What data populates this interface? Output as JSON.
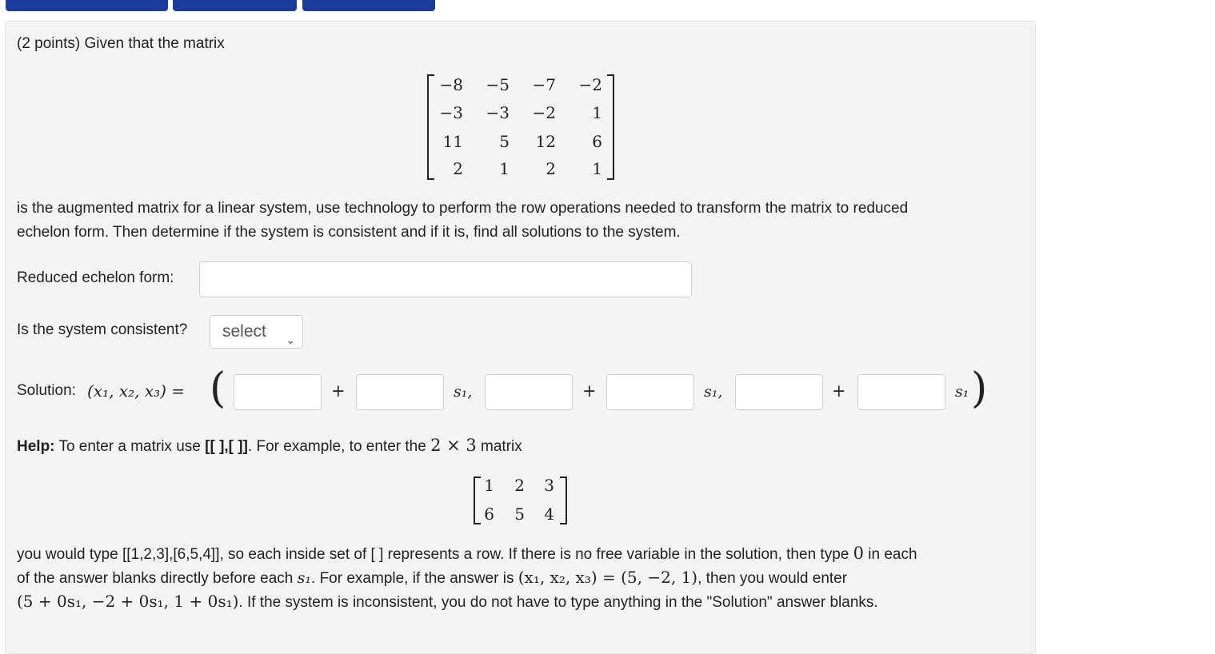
{
  "question": {
    "intro": "(2 points) Given that the matrix",
    "matrix": [
      [
        "−8",
        "−5",
        "−7",
        "−2"
      ],
      [
        "−3",
        "−3",
        "−2",
        "1"
      ],
      [
        "11",
        "5",
        "12",
        "6"
      ],
      [
        "2",
        "1",
        "2",
        "1"
      ]
    ],
    "description_line1": "is the augmented matrix for a linear system, use technology to perform the row operations needed to transform the matrix to reduced",
    "description_line2": "echelon form. Then determine if the system is consistent and if it is, find all solutions to the system."
  },
  "fields": {
    "reduced_label": "Reduced echelon form:",
    "reduced_value": "",
    "consistent_label": "Is the system consistent?",
    "consistent_selected": "select",
    "solution_label": "Solution:",
    "solution_lhs": "(x₁, x₂, x₃) =",
    "plus": "+",
    "s1_comma": "s₁,",
    "s1": "s₁"
  },
  "help": {
    "bold": "Help:",
    "text1": "To enter a matrix use",
    "syntax": "[[ ],[ ]]",
    "text2": ". For example, to enter the",
    "dims": "2 × 3",
    "text3": "matrix",
    "example_matrix": [
      [
        "1",
        "2",
        "3"
      ],
      [
        "6",
        "5",
        "4"
      ]
    ],
    "para1a": "you would type [[1,2,3],[6,5,4]], so each inside set of [ ] represents a row. If there is no free variable in the solution, then type",
    "zero": "0",
    "para1b": "in each",
    "para2a": "of the answer blanks directly before each",
    "s1": "s₁",
    "para2b": ". For example, if the answer is",
    "eq": "(x₁, x₂, x₃) = (5, −2, 1)",
    "para2c": ", then you would enter",
    "entry": "(5 + 0s₁, −2 + 0s₁, 1 + 0s₁)",
    "para3": ". If the system is inconsistent, you do not have to type anything in the \"Solution\" answer blanks."
  },
  "colors": {
    "top_button": "#1d3b9a",
    "panel_bg": "#f4f4f4"
  }
}
